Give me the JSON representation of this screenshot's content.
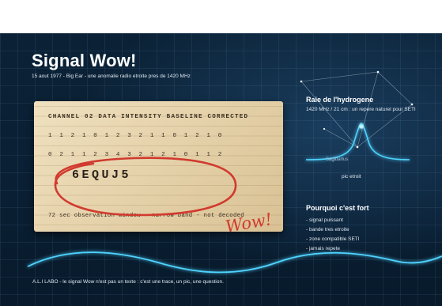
{
  "title": "Signal Wow!",
  "subtitle": "15 aout 1977 - Big Ear - une anomalie radio etroite pres de 1420 MHz",
  "card": {
    "header": "CHANNEL 02 DATA INTENSITY BASELINE CORRECTED",
    "row1": "1 1 2 1 0 1 2 3 2 1 1 0 1 2 1 0",
    "row2": "0 2 1 1 2 3 4 3 2 1 2 1 0 1 1 2",
    "code": "6EQUJ5",
    "footer": "72 sec observation window - narrow band - not decoded",
    "wow": "Wow!"
  },
  "hydrogen": {
    "title": "Raie de l'hydrogene",
    "desc": "1420 MHz / 21 cm : un repere naturel pour SETI",
    "constellation": "Sagittarius",
    "peak_caption": "pic etroit"
  },
  "why": {
    "title": "Pourquoi c'est fort",
    "items": [
      "- signal puissant",
      "- bande tres etroite",
      "- zone compatible SETI",
      "- jamais repete"
    ]
  },
  "footer": "A.L.I LABO - le signal Wow n'est pas un texte : c'est une trace, un pic, une question.",
  "colors": {
    "background": "#0b2236",
    "accent": "#4fd4ff",
    "annotation": "#d13a2e",
    "card": "#e6d3ac"
  }
}
